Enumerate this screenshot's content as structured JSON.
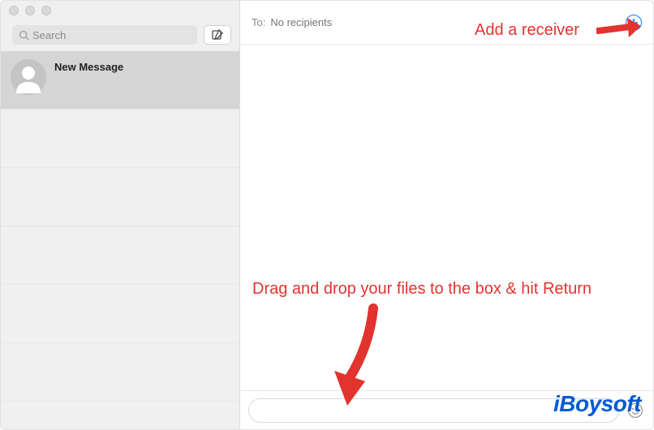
{
  "sidebar": {
    "search_placeholder": "Search",
    "conversations": [
      {
        "title": "New Message"
      }
    ]
  },
  "to_field": {
    "label": "To:",
    "placeholder": "No recipients"
  },
  "compose": {
    "message_placeholder": ""
  },
  "annotations": {
    "add_receiver": "Add a receiver",
    "drag_drop": "Drag and drop your files to the box & hit Return"
  },
  "watermark": "iBoysoft",
  "colors": {
    "annotation": "#e2332f",
    "accent_blue": "#0c7dff",
    "watermark_blue": "#005ad2"
  }
}
